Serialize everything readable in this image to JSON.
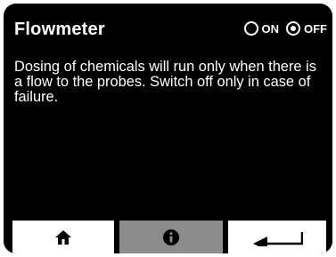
{
  "header": {
    "title": "Flowmeter"
  },
  "toggle": {
    "on_label": "ON",
    "off_label": "OFF",
    "selected": "OFF"
  },
  "description": "Dosing of chemicals will run only when there is a flow to the probes. Switch off only in case of failure.",
  "footer": {
    "buttons": [
      {
        "icon": "home-icon"
      },
      {
        "icon": "info-icon",
        "active": true
      },
      {
        "icon": "return-arrow-icon"
      }
    ]
  },
  "colors": {
    "screen_background": "#000000",
    "text": "#ffffff",
    "button_background": "#ffffff",
    "active_button_background": "#8c8c8c"
  }
}
